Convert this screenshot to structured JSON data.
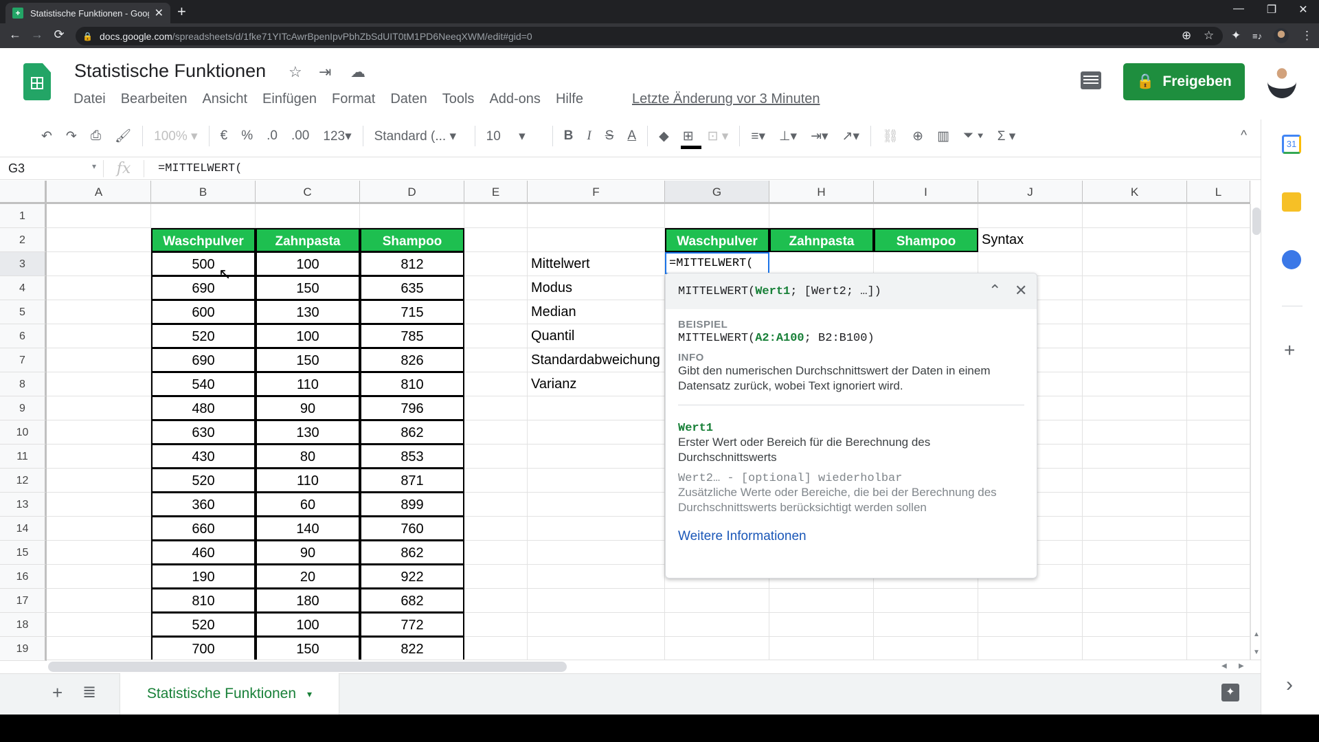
{
  "browser": {
    "tab_title": "Statistische Funktionen - Google",
    "url_host": "docs.google.com",
    "url_path": "/spreadsheets/d/1fke71YITcAwrBpenIpvPbhZbSdUIT0tM1PD6NeeqXWM/edit#gid=0",
    "icons": {
      "back": "←",
      "forward": "→",
      "reload": "⟳",
      "lock": "🔒",
      "zoom": "⊕",
      "star": "☆",
      "extensions": "✦",
      "media": "≡♪",
      "menu": "⋮",
      "minimize": "—",
      "restore": "❐",
      "close": "✕",
      "newtab": "+",
      "tabclose": "✕"
    }
  },
  "doc": {
    "title": "Statistische Funktionen",
    "menu": [
      "Datei",
      "Bearbeiten",
      "Ansicht",
      "Einfügen",
      "Format",
      "Daten",
      "Tools",
      "Add-ons",
      "Hilfe"
    ],
    "last_edit": "Letzte Änderung vor 3 Minuten",
    "share_label": "Freigeben",
    "title_icons": {
      "star": "☆",
      "move": "⇥",
      "cloud": "☁"
    }
  },
  "toolbar": {
    "zoom": "100%",
    "currency": "€",
    "percent": "%",
    "dec_decrease": ".0",
    "dec_increase": ".00",
    "more_formats": "123",
    "font": "Standard (...",
    "font_size": "10",
    "bold": "B",
    "italic": "I",
    "strike": "S",
    "text_color": "A",
    "sum": "Σ",
    "collapse": "^"
  },
  "formula_bar": {
    "name_box": "G3",
    "fx": "fx",
    "content": "=MITTELWERT("
  },
  "grid": {
    "columns": [
      "A",
      "B",
      "C",
      "D",
      "E",
      "F",
      "G",
      "H",
      "I",
      "J",
      "K",
      "L"
    ],
    "selected_column": "G",
    "rows": [
      "1",
      "2",
      "3",
      "4",
      "5",
      "6",
      "7",
      "8",
      "9",
      "10",
      "11",
      "12",
      "13",
      "14",
      "15",
      "16",
      "17",
      "18",
      "19"
    ],
    "selected_row": "3",
    "table_headers": [
      "Waschpulver",
      "Zahnpasta",
      "Shampoo"
    ],
    "table_values": [
      [
        500,
        100,
        812
      ],
      [
        690,
        150,
        635
      ],
      [
        600,
        130,
        715
      ],
      [
        520,
        100,
        785
      ],
      [
        690,
        150,
        826
      ],
      [
        540,
        110,
        810
      ],
      [
        480,
        90,
        796
      ],
      [
        630,
        130,
        862
      ],
      [
        430,
        80,
        853
      ],
      [
        520,
        110,
        871
      ],
      [
        360,
        60,
        899
      ],
      [
        660,
        140,
        760
      ],
      [
        460,
        90,
        862
      ],
      [
        190,
        20,
        922
      ],
      [
        810,
        180,
        682
      ],
      [
        520,
        100,
        772
      ],
      [
        700,
        150,
        822
      ]
    ],
    "stat_labels": [
      "Mittelwert",
      "Modus",
      "Median",
      "Quantil",
      "Standardabweichung",
      "Varianz"
    ],
    "result_headers": [
      "Waschpulver",
      "Zahnpasta",
      "Shampoo"
    ],
    "syntax_label": "Syntax",
    "active_cell_value": "=MITTELWERT("
  },
  "help_card": {
    "signature_fn": "MITTELWERT(",
    "signature_arg1": "Wert1",
    "signature_rest": "; [Wert2; …])",
    "example_label": "BEISPIEL",
    "example_fn": "MITTELWERT(",
    "example_arg": "A2:A100",
    "example_rest": "; B2:B100)",
    "info_label": "INFO",
    "info_text": "Gibt den numerischen Durchschnittswert der Daten in einem Datensatz zurück, wobei Text ignoriert wird.",
    "arg1_name": "Wert1",
    "arg1_desc": "Erster Wert oder Bereich für die Berechnung des Durchschnittswerts",
    "arg2_name": "Wert2… - [optional] wiederholbar",
    "arg2_desc": "Zusätzliche Werte oder Bereiche, die bei der Berechnung des Durchschnittswerts berücksichtigt werden sollen",
    "more_link": "Weitere Informationen",
    "collapse_icon": "⌃",
    "close_icon": "✕"
  },
  "sheets": {
    "add": "+",
    "list": "≣",
    "active_tab": "Statistische Funktionen",
    "tab_menu": "▾",
    "explore": "✦"
  },
  "side_panel": {
    "calendar_label": "31",
    "add": "+",
    "expand": "›"
  },
  "colors": {
    "header_green": "#1ebf50",
    "share_green": "#1e8e3e",
    "active_blue": "#1a73e8",
    "link_blue": "#1a57b8",
    "arg_green": "#188038"
  }
}
